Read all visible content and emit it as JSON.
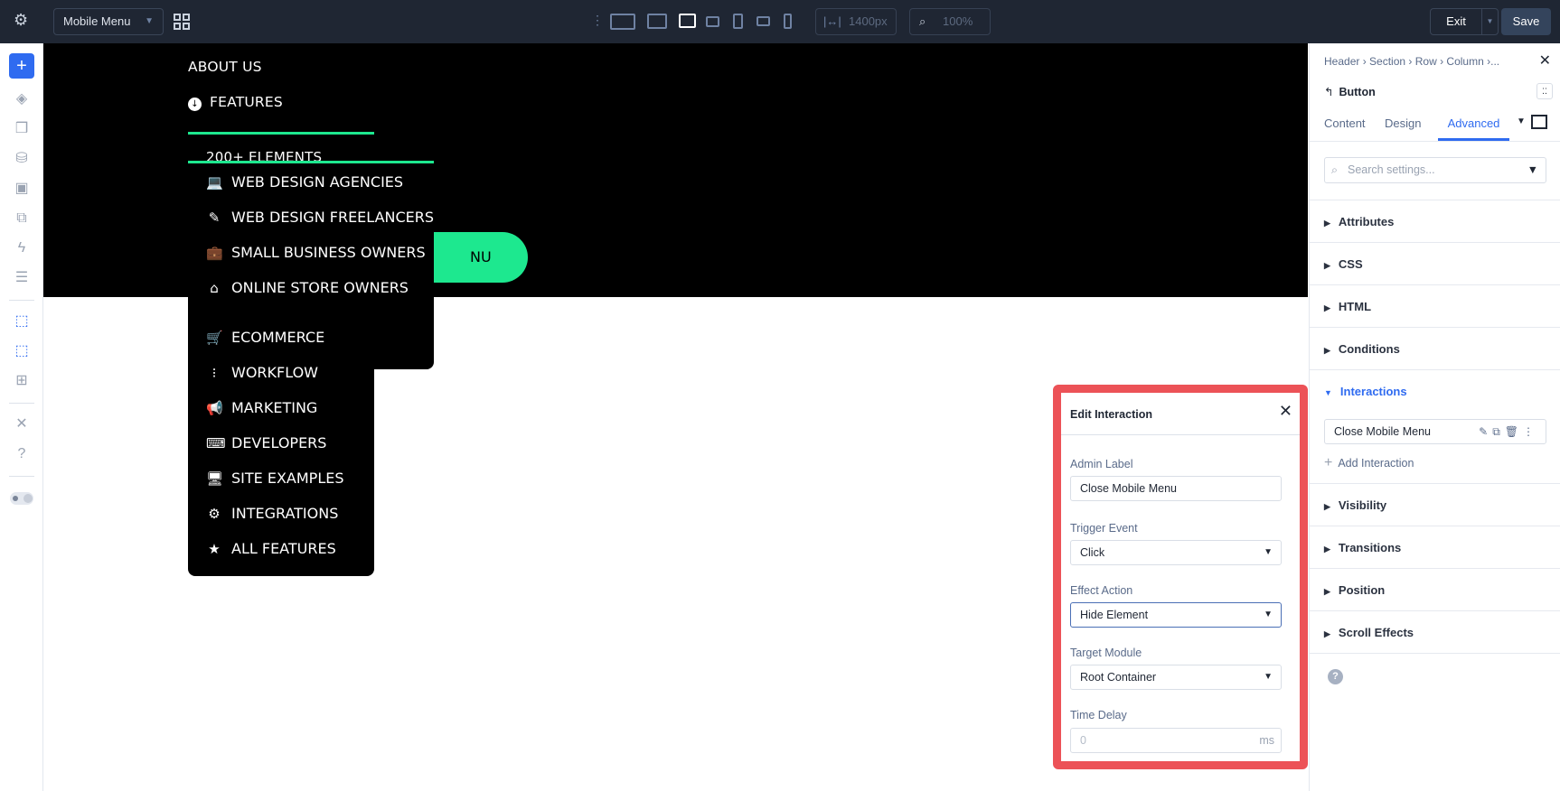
{
  "topbar": {
    "page_select": "Mobile Menu",
    "width_value": "1400px",
    "zoom_value": "100%",
    "exit_label": "Exit",
    "save_label": "Save"
  },
  "canvas": {
    "top_items": [
      "ABOUT US",
      "FEATURES"
    ],
    "clipped_item": "200+ ELEMENTS",
    "submenu": [
      "WEB DESIGN AGENCIES",
      "WEB DESIGN FREELANCERS",
      "SMALL BUSINESS OWNERS",
      "ONLINE STORE OWNERS"
    ],
    "features": [
      "ECOMMERCE",
      "WORKFLOW",
      "MARKETING",
      "DEVELOPERS",
      "SITE EXAMPLES",
      "INTEGRATIONS",
      "ALL FEATURES"
    ],
    "button_visible_text": "NU",
    "accent": "#1de88f"
  },
  "panel": {
    "breadcrumb": [
      "Header",
      "Section",
      "Row",
      "Column",
      "..."
    ],
    "module": "Button",
    "tabs": [
      "Content",
      "Design",
      "Advanced"
    ],
    "active_tab": "Advanced",
    "search_placeholder": "Search settings...",
    "sections": [
      "Attributes",
      "CSS",
      "HTML",
      "Conditions",
      "Interactions",
      "Visibility",
      "Transitions",
      "Position",
      "Scroll Effects"
    ],
    "interaction_item": "Close Mobile Menu",
    "add_interaction": "Add Interaction"
  },
  "popup": {
    "title": "Edit Interaction",
    "admin_label": "Admin Label",
    "admin_value": "Close Mobile Menu",
    "trigger_label": "Trigger Event",
    "trigger_value": "Click",
    "effect_label": "Effect Action",
    "effect_value": "Hide Element",
    "target_label": "Target Module",
    "target_value": "Root Container",
    "delay_label": "Time Delay",
    "delay_placeholder": "0",
    "delay_unit": "ms",
    "highlight": "#ec5257"
  }
}
